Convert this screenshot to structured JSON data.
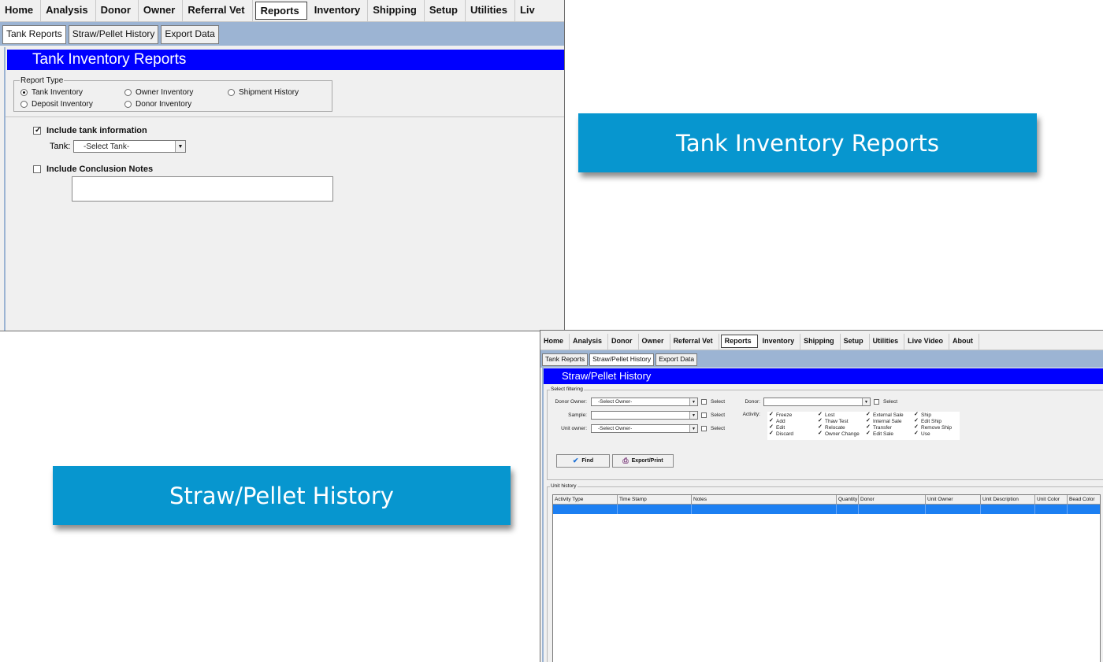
{
  "screen1": {
    "menu": [
      "Home",
      "Analysis",
      "Donor",
      "Owner",
      "Referral Vet",
      "Reports",
      "Inventory",
      "Shipping",
      "Setup",
      "Utilities",
      "Liv"
    ],
    "active_menu": "Reports",
    "subtabs": [
      "Tank Reports",
      "Straw/Pellet History",
      "Export Data"
    ],
    "active_subtab": "Tank Reports",
    "banner": "Tank Inventory Reports",
    "report_type": {
      "title": "Report Type",
      "options": [
        "Tank Inventory",
        "Owner Inventory",
        "Shipment History",
        "Deposit Inventory",
        "Donor Inventory"
      ],
      "selected": "Tank Inventory"
    },
    "include_tank": {
      "label": "Include tank information",
      "checked": true
    },
    "tank": {
      "label": "Tank:",
      "value": "-Select Tank-"
    },
    "include_notes": {
      "label": "Include Conclusion Notes",
      "checked": false
    },
    "notes_value": ""
  },
  "captions": {
    "caption1": "Tank Inventory Reports",
    "caption2": "Straw/Pellet History"
  },
  "screen2": {
    "menu": [
      "Home",
      "Analysis",
      "Donor",
      "Owner",
      "Referral Vet",
      "Reports",
      "Inventory",
      "Shipping",
      "Setup",
      "Utilities",
      "Live Video",
      "About"
    ],
    "active_menu": "Reports",
    "subtabs": [
      "Tank Reports",
      "Straw/Pellet History",
      "Export Data"
    ],
    "active_subtab": "Straw/Pellet History",
    "banner": "Straw/Pellet History",
    "filter_title": "Select filtering",
    "donor_owner": {
      "label": "Donor Owner:",
      "value": "-Select Owner-"
    },
    "sample": {
      "label": "Sample:",
      "value": ""
    },
    "unit_owner": {
      "label": "Unit owner:",
      "value": "-Select Owner-"
    },
    "select_label": "Select",
    "donor": {
      "label": "Donor:",
      "value": ""
    },
    "activity_label": "Activity:",
    "activities": [
      {
        "label": "Freeze",
        "checked": true
      },
      {
        "label": "Add",
        "checked": true
      },
      {
        "label": "Edit",
        "checked": true
      },
      {
        "label": "Discard",
        "checked": true
      },
      {
        "label": "Lost",
        "checked": true
      },
      {
        "label": "Thaw Test",
        "checked": true
      },
      {
        "label": "Relocate",
        "checked": true
      },
      {
        "label": "Owner Change",
        "checked": true
      },
      {
        "label": "External Sale",
        "checked": true
      },
      {
        "label": "Internal Sale",
        "checked": true
      },
      {
        "label": "Transfer",
        "checked": true
      },
      {
        "label": "Edit Sale",
        "checked": true
      },
      {
        "label": "Ship",
        "checked": true
      },
      {
        "label": "Edit Ship",
        "checked": true
      },
      {
        "label": "Remove Ship",
        "checked": true
      },
      {
        "label": "Use",
        "checked": true
      }
    ],
    "find_label": "Find",
    "export_label": "Export/Print",
    "unit_history_title": "Unit history",
    "columns": [
      "Activity Type",
      "Time Stamp",
      "Notes",
      "Quantity",
      "Donor",
      "Unit Owner",
      "Unit Description",
      "Unit Color",
      "Bead Color"
    ],
    "accent_color": "#0000ff",
    "selection_color": "#1c7ff2"
  }
}
